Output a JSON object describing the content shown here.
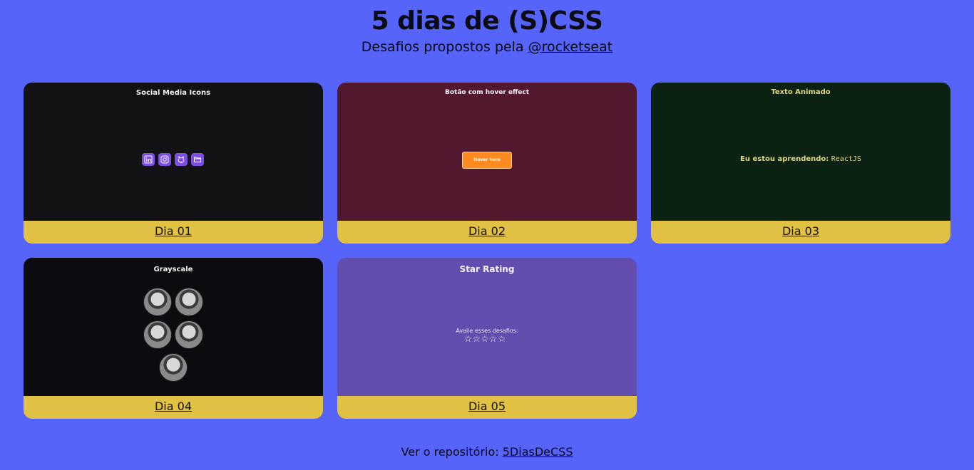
{
  "header": {
    "title": "5 dias de (S)CSS",
    "subtitle_prefix": "Desafios propostos pela ",
    "subtitle_link": "@rocketseat"
  },
  "cards": [
    {
      "caption": "Dia 01",
      "preview_title": "Social Media Icons",
      "icons": [
        "linkedin-icon",
        "instagram-icon",
        "github-icon",
        "folder-icon"
      ]
    },
    {
      "caption": "Dia 02",
      "preview_title": "Botão com hover effect",
      "button_label": "Hover here"
    },
    {
      "caption": "Dia 03",
      "preview_title": "Texto Animado",
      "text_prefix": "Eu estou aprendendo: ",
      "text_mono": "ReactJS"
    },
    {
      "caption": "Dia 04",
      "preview_title": "Grayscale"
    },
    {
      "caption": "Dia 05",
      "preview_title": "Star Rating",
      "rating_label": "Avalie esses desafios:",
      "star_glyph": "☆"
    }
  ],
  "footer": {
    "prefix": "Ver o repositório: ",
    "link": "5DiasDeCSS"
  },
  "colors": {
    "background": "#5764fa",
    "caption_bar": "#e1c144",
    "card1": "#121214",
    "card2": "#52192e",
    "card3": "#0b2112",
    "card4": "#0c0b10",
    "card5": "#634eaf",
    "button": "#ff8a1f",
    "icon": "#7b4fe0"
  }
}
